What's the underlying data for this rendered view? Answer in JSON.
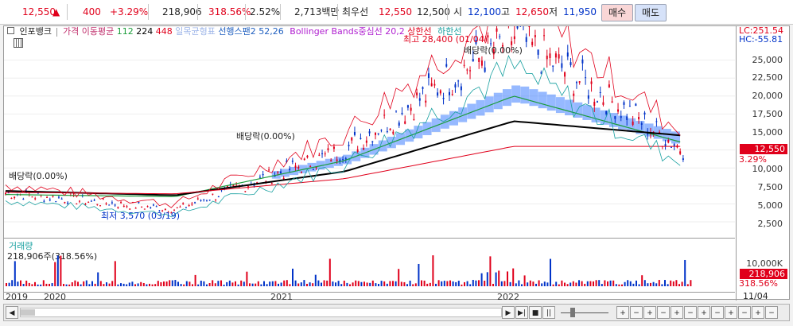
{
  "quote": {
    "price": "12,550",
    "change_arrow": "▲",
    "change": "400",
    "change_pct": "+3.29%",
    "volume": "218,906",
    "volume_ratio": "318.56%",
    "turnover_pct": "2.52%",
    "amount": "2,713백만",
    "ask_label": "최우선",
    "ask": "12,550",
    "bid": "12,500",
    "open_label": "시",
    "open": "12,100",
    "high_label": "고",
    "high": "12,650",
    "low_label": "저",
    "low": "11,950",
    "buy_label": "매수",
    "sell_label": "매도"
  },
  "legend": {
    "stock_name": "인포뱅크",
    "ma_label": "가격 이동평균",
    "ma_112": "112",
    "ma_224": "224",
    "ma_448": "448",
    "ichimoku_label": "선행스팬2 52,26",
    "bollinger_label": "Bollinger Bands중심선 20,2",
    "upper_label": "상한선",
    "lower_label": "하한선",
    "lc": "LC:251.54",
    "hc": "HC:-55.81"
  },
  "annotations": {
    "dividend_2019": "배당락(0.00%)",
    "dividend_2020": "배당락(0.00%)",
    "dividend_2021": "배당락(0.00%)",
    "high_marker": "최고 28,400 (01/04)",
    "low_marker": "최저 3,570 (03/19)"
  },
  "price_axis": [
    "25,000",
    "22,500",
    "20,000",
    "17,500",
    "15,000",
    "12,500",
    "10,000",
    "7,500",
    "5,000",
    "2,500"
  ],
  "last_price_label": "12,550",
  "last_change_label": "3.29%",
  "volume_pane": {
    "title": "거래량",
    "value": "218,906주(318.56%)",
    "axis_label": "10,000K",
    "last_label": "218,906",
    "ratio_label": "318.56%"
  },
  "x_axis": [
    "2019",
    "2020",
    "2021",
    "2022",
    "11/04"
  ],
  "colors": {
    "up": "#e0001b",
    "down": "#0032c8",
    "cloud": "#3f7fff",
    "ma112": "#1a9c3a",
    "ma224": "#000000",
    "ma448": "#e0001b"
  },
  "chart_data": {
    "type": "line",
    "x": [
      "2019",
      "2020",
      "2021",
      "2022",
      "11/04"
    ],
    "series": [
      {
        "name": "가격",
        "values": [
          6500,
          4200,
          12500,
          28400,
          12550
        ]
      },
      {
        "name": "112",
        "values": [
          6300,
          6000,
          11000,
          20000,
          13500
        ]
      },
      {
        "name": "224",
        "values": [
          6800,
          6200,
          9500,
          16500,
          14500
        ]
      },
      {
        "name": "448",
        "values": [
          6600,
          6400,
          8500,
          13000,
          13000
        ]
      }
    ],
    "ylim": [
      2500,
      27500
    ]
  }
}
